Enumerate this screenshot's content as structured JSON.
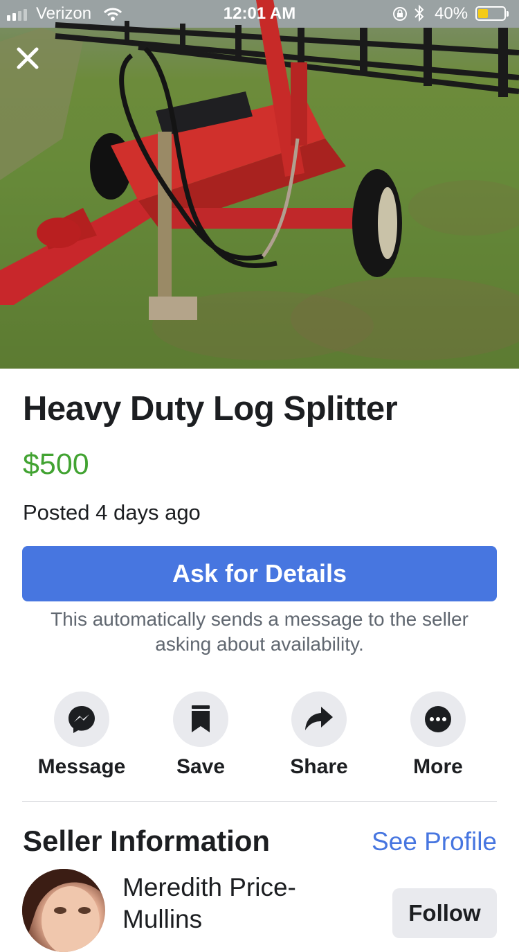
{
  "status_bar": {
    "carrier": "Verizon",
    "time": "12:01 AM",
    "battery_percent": "40%",
    "battery_level": 0.4,
    "battery_color": "#f5cb16"
  },
  "listing": {
    "title": "Heavy Duty Log Splitter",
    "price": "$500",
    "posted": "Posted 4 days ago",
    "ask_button_label": "Ask for Details",
    "ask_note": "This automatically sends a message to the seller asking about availability."
  },
  "actions": [
    {
      "label": "Message",
      "icon": "messenger-icon"
    },
    {
      "label": "Save",
      "icon": "bookmark-icon"
    },
    {
      "label": "Share",
      "icon": "share-arrow-icon"
    },
    {
      "label": "More",
      "icon": "more-dots-icon"
    }
  ],
  "seller": {
    "heading": "Seller Information",
    "see_profile_label": "See Profile",
    "name": "Meredith Price-Mullins",
    "follow_label": "Follow"
  },
  "colors": {
    "accent_blue": "#4776e0",
    "price_green": "#42a332",
    "action_circle": "#e9eaee"
  }
}
